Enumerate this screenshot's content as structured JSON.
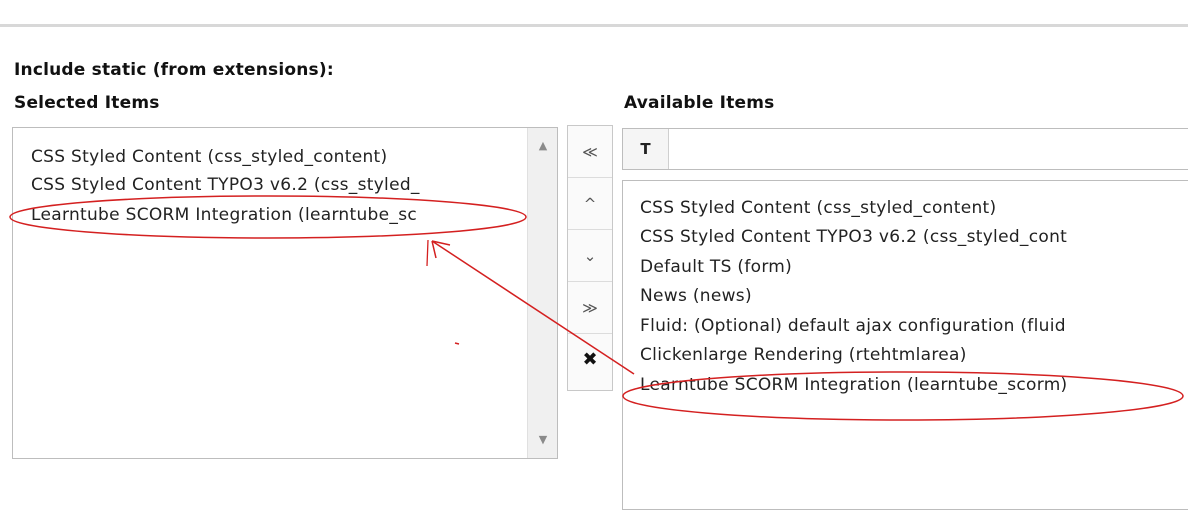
{
  "header": {
    "section_title": "Include static (from extensions):",
    "selected_heading": "Selected Items",
    "available_heading": "Available Items"
  },
  "selected_items": [
    "CSS Styled Content (css_styled_content)",
    "CSS Styled Content TYPO3 v6.2 (css_styled_",
    "Learntube SCORM Integration (learntube_sc"
  ],
  "available_items": [
    "CSS Styled Content (css_styled_content)",
    "CSS Styled Content TYPO3 v6.2 (css_styled_cont",
    "Default TS (form)",
    "News (news)",
    "Fluid: (Optional) default ajax configuration (fluid",
    "Clickenlarge Rendering (rtehtmlarea)",
    "Learntube SCORM Integration (learntube_scorm)"
  ],
  "buttons": {
    "move_top": "≪",
    "move_up": "^",
    "move_down": "⌄",
    "move_bottom": "≫",
    "remove": "✖"
  },
  "filter": {
    "icon": "T",
    "placeholder": ""
  },
  "colors": {
    "annotation": "#d42020"
  }
}
